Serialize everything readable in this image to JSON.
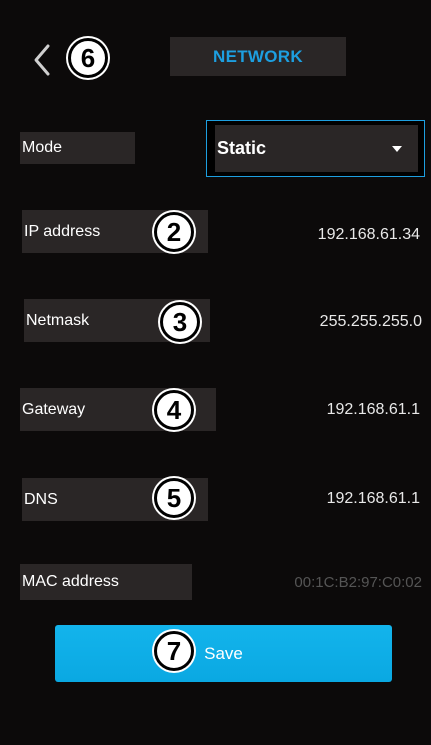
{
  "header": {
    "title": "NETWORK",
    "back_icon": "chevron-left-icon",
    "back_callout": "6"
  },
  "mode": {
    "label": "Mode",
    "selected": "Static",
    "dropdown_icon": "caret-down-icon"
  },
  "fields": [
    {
      "label": "IP address",
      "value": "192.168.61.34",
      "callout": "2"
    },
    {
      "label": "Netmask",
      "value": "255.255.255.0",
      "callout": "3"
    },
    {
      "label": "Gateway",
      "value": "192.168.61.1",
      "callout": "4"
    },
    {
      "label": "DNS",
      "value": "192.168.61.1",
      "callout": "5"
    }
  ],
  "mac": {
    "label": "MAC address",
    "value": "00:1C:B2:97:C0:02"
  },
  "save": {
    "label": "Save",
    "callout": "7"
  },
  "colors": {
    "accent": "#1d9fe0",
    "button": "#13b4ec",
    "panel": "#2a2626",
    "background": "#0c0a0a"
  }
}
